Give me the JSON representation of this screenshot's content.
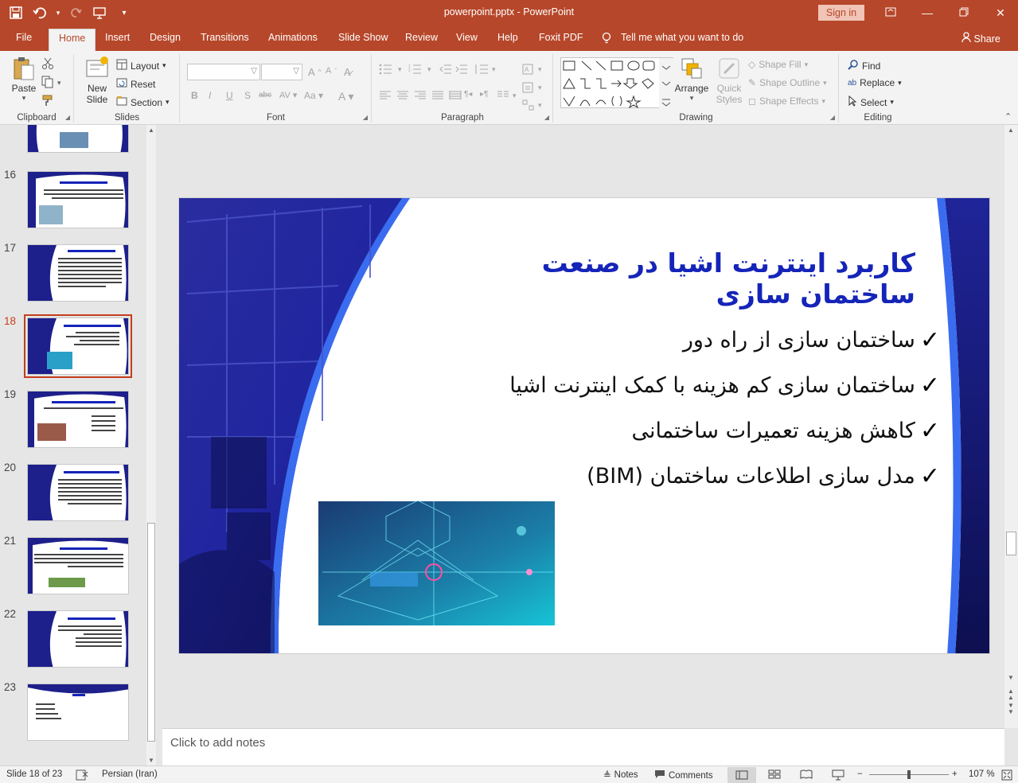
{
  "window": {
    "title": "powerpoint.pptx  -  PowerPoint",
    "sign_in": "Sign in"
  },
  "tabs": [
    "File",
    "Home",
    "Insert",
    "Design",
    "Transitions",
    "Animations",
    "Slide Show",
    "Review",
    "View",
    "Help",
    "Foxit PDF"
  ],
  "active_tab": "Home",
  "tell_me": "Tell me what you want to do",
  "share": "Share",
  "ribbon": {
    "clipboard": {
      "label": "Clipboard",
      "paste": "Paste"
    },
    "slides": {
      "label": "Slides",
      "new_slide": "New Slide",
      "layout": "Layout",
      "reset": "Reset",
      "section": "Section"
    },
    "font": {
      "label": "Font"
    },
    "paragraph": {
      "label": "Paragraph"
    },
    "drawing": {
      "label": "Drawing",
      "arrange": "Arrange",
      "quick_styles": "Quick Styles",
      "shape_fill": "Shape Fill",
      "shape_outline": "Shape Outline",
      "shape_effects": "Shape Effects"
    },
    "editing": {
      "label": "Editing",
      "find": "Find",
      "replace": "Replace",
      "select": "Select"
    }
  },
  "thumbnails": [
    {
      "number": "16"
    },
    {
      "number": "17"
    },
    {
      "number": "18",
      "active": true
    },
    {
      "number": "19"
    },
    {
      "number": "20"
    },
    {
      "number": "21"
    },
    {
      "number": "22"
    },
    {
      "number": "23"
    }
  ],
  "slide": {
    "title": "کاربرد اینترنت اشیا در صنعت ساختمان سازی",
    "bullets": [
      "ساختمان سازی از راه دور",
      "ساختمان سازی کم هزینه با کمک اینترنت اشیا",
      "کاهش هزینه تعمیرات ساختمانی",
      "مدل سازی اطلاعات ساختمان (BIM)"
    ],
    "check_glyph": "✓"
  },
  "notes_placeholder": "Click to add notes",
  "status": {
    "slide_info": "Slide 18 of 23",
    "language": "Persian (Iran)",
    "notes": "Notes",
    "comments": "Comments",
    "zoom": "107 %"
  },
  "colors": {
    "accent": "#b7472a",
    "slide_title": "#1524b8",
    "slide_bg_dark": "#1d1f8a"
  }
}
